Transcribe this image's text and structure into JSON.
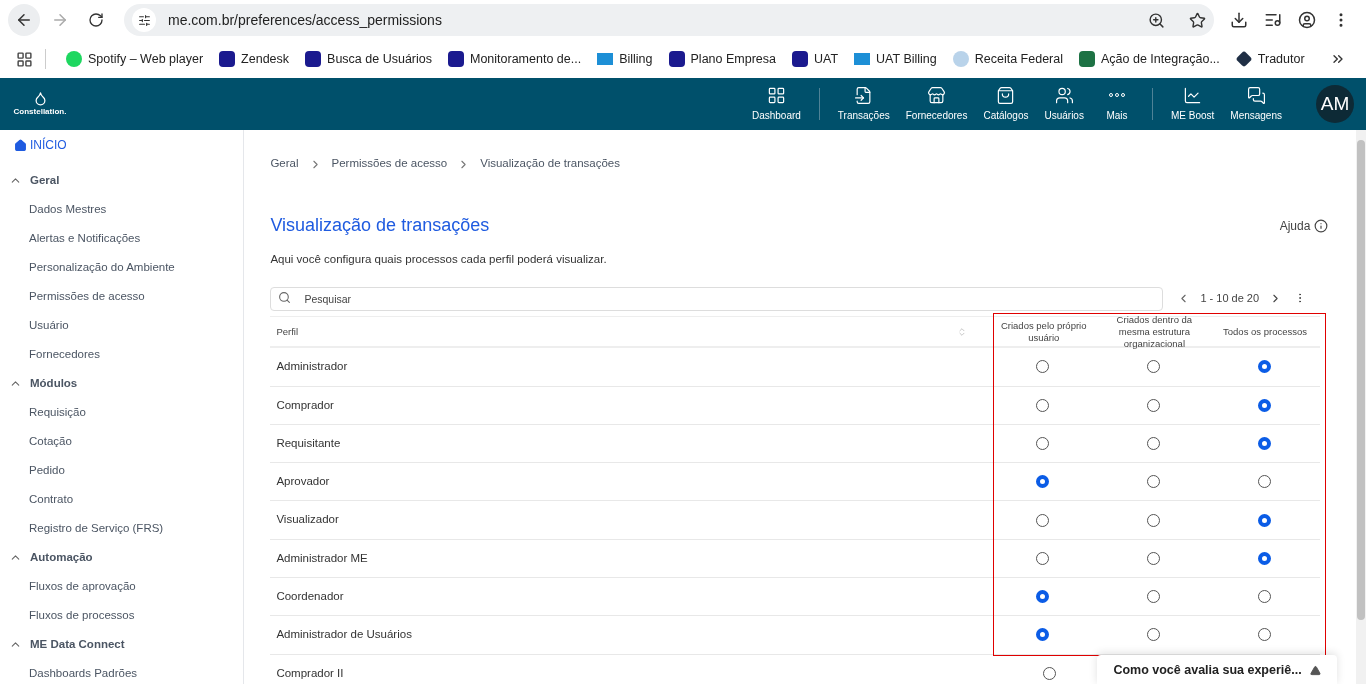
{
  "browser": {
    "url": "me.com.br/preferences/access_permissions",
    "bookmarks": [
      {
        "label": "Spotify – Web player",
        "kind": "spotify"
      },
      {
        "label": "Zendesk",
        "kind": "me"
      },
      {
        "label": "Busca de Usuários",
        "kind": "me"
      },
      {
        "label": "Monitoramento de...",
        "kind": "me"
      },
      {
        "label": "Billing",
        "kind": "m"
      },
      {
        "label": "Plano Empresa",
        "kind": "me"
      },
      {
        "label": "UAT",
        "kind": "me"
      },
      {
        "label": "UAT Billing",
        "kind": "m"
      },
      {
        "label": "Receita Federal",
        "kind": "gov"
      },
      {
        "label": "Ação de Integração...",
        "kind": "excel"
      },
      {
        "label": "Tradutor",
        "kind": "translate"
      }
    ]
  },
  "header": {
    "brand": "Constellation.",
    "avatar": "AM",
    "nav_groups": [
      [
        {
          "label": "Dashboard",
          "kind": "dashboard"
        }
      ],
      [
        {
          "label": "Transações",
          "kind": "transactions"
        },
        {
          "label": "Fornecedores",
          "kind": "store"
        },
        {
          "label": "Catálogos",
          "kind": "bag"
        },
        {
          "label": "Usuários",
          "kind": "users"
        },
        {
          "label": "Mais",
          "kind": "more"
        }
      ],
      [
        {
          "label": "ME Boost",
          "kind": "chart"
        },
        {
          "label": "Mensagens",
          "kind": "messages"
        }
      ]
    ]
  },
  "sidebar": {
    "home": "INÍCIO",
    "sections": [
      {
        "title": "Geral",
        "expanded": true,
        "items": [
          "Dados Mestres",
          "Alertas e Notificações",
          "Personalização do Ambiente",
          "Permissões de acesso",
          "Usuário",
          "Fornecedores"
        ]
      },
      {
        "title": "Módulos",
        "expanded": true,
        "items": [
          "Requisição",
          "Cotação",
          "Pedido",
          "Contrato",
          "Registro de Serviço (FRS)"
        ]
      },
      {
        "title": "Automação",
        "expanded": true,
        "items": [
          "Fluxos de aprovação",
          "Fluxos de processos"
        ]
      },
      {
        "title": "ME Data Connect",
        "expanded": true,
        "items": [
          "Dashboards Padrões"
        ]
      }
    ]
  },
  "breadcrumb": [
    "Geral",
    "Permissões de acesso",
    "Visualização de transações"
  ],
  "page": {
    "title": "Visualização de transações",
    "help": "Ajuda",
    "description": "Aqui você configura quais processos cada perfil poderá visualizar.",
    "search_placeholder": "Pesquisar",
    "pagination": "1 - 10 de 20"
  },
  "table": {
    "columns": [
      "Perfil",
      "Criados pelo próprio usuário",
      "Criados dentro da mesma estrutura organizacional",
      "Todos os processos"
    ],
    "rows": [
      {
        "profile": "Administrador",
        "options": [
          {
            "selected": false
          },
          {
            "selected": false
          },
          {
            "selected": true
          }
        ]
      },
      {
        "profile": "Comprador",
        "options": [
          {
            "selected": false
          },
          {
            "selected": false
          },
          {
            "selected": true
          }
        ]
      },
      {
        "profile": "Requisitante",
        "options": [
          {
            "selected": false
          },
          {
            "selected": false
          },
          {
            "selected": true
          }
        ]
      },
      {
        "profile": "Aprovador",
        "options": [
          {
            "selected": true
          },
          {
            "selected": false
          },
          {
            "selected": false
          }
        ]
      },
      {
        "profile": "Visualizador",
        "options": [
          {
            "selected": false
          },
          {
            "selected": false
          },
          {
            "selected": true
          }
        ]
      },
      {
        "profile": "Administrador ME",
        "options": [
          {
            "selected": false
          },
          {
            "selected": false
          },
          {
            "selected": true
          }
        ]
      },
      {
        "profile": "Coordenador",
        "options": [
          {
            "selected": true
          },
          {
            "selected": false
          },
          {
            "selected": false
          }
        ]
      },
      {
        "profile": "Administrador de Usuários",
        "options": [
          {
            "selected": true
          },
          {
            "selected": false
          },
          {
            "selected": false
          }
        ]
      },
      {
        "profile": "Comprador II",
        "options": [
          {
            "selected": false
          }
        ]
      }
    ]
  },
  "feedback": {
    "label": "Como você avalia sua experiê..."
  }
}
